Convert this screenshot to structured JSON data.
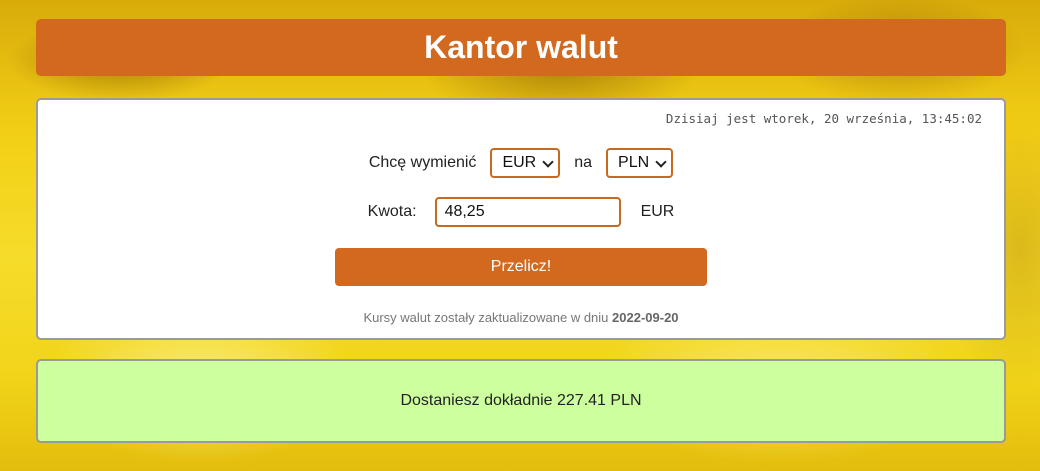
{
  "header": {
    "title": "Kantor walut"
  },
  "converter": {
    "datetime": "Dzisiaj jest wtorek, 20 września, 13:45:02",
    "want_label": "Chcę wymienić",
    "from_currency": "EUR",
    "to_label": "na",
    "to_currency": "PLN",
    "amount_label": "Kwota:",
    "amount_value": "48,25",
    "amount_unit": "EUR",
    "submit_label": "Przelicz!",
    "updated_text": "Kursy walut zostały zaktualizowane w dniu",
    "updated_date": "2022-09-20"
  },
  "result": {
    "text": "Dostaniesz dokładnie 227.41 PLN"
  },
  "colors": {
    "accent": "#d2691e",
    "result_bg": "#ceff9e",
    "panel_bg": "#ffffff"
  },
  "icons": {
    "dropdown": "chevron-down-icon"
  }
}
